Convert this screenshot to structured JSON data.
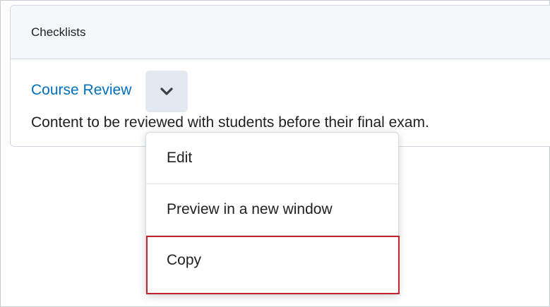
{
  "card": {
    "title": "Checklists",
    "course_link": "Course Review",
    "description": "Content to be reviewed with students before their final exam."
  },
  "menu": {
    "items": [
      {
        "label": "Edit"
      },
      {
        "label": "Preview in a new window"
      },
      {
        "label": "Copy"
      }
    ],
    "highlighted_item": "Copy",
    "highlight_color": "#c0272d"
  },
  "colors": {
    "link": "#006fbf",
    "header_bg": "#f5f7fb",
    "button_bg": "#e3e9f1"
  },
  "icons": {
    "dropdown": "chevron-down-icon"
  }
}
